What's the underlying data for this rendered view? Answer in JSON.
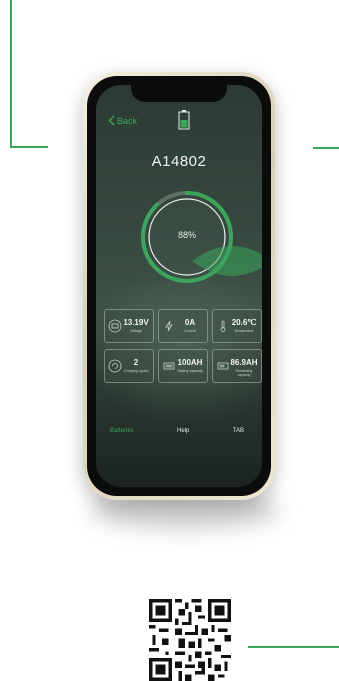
{
  "app": {
    "back_label": "Back",
    "device_name": "A14802",
    "charge_percent": 88,
    "charge_label": "88%"
  },
  "stats": [
    {
      "value": "13.19V",
      "label": "Voltage",
      "icon": "battery-icon"
    },
    {
      "value": "0A",
      "label": "Current",
      "icon": "current-icon"
    },
    {
      "value": "20.6℃",
      "label": "Temperature",
      "icon": "thermometer-icon"
    },
    {
      "value": "2",
      "label": "Charging cycles",
      "icon": "cycle-icon"
    },
    {
      "value": "100AH",
      "label": "Battery capacity",
      "icon": "capacity-icon"
    },
    {
      "value": "86.9AH",
      "label": "Remaining capacity",
      "icon": "remaining-capacity-icon"
    }
  ],
  "tabs": [
    {
      "label": "Batteries",
      "active": true
    },
    {
      "label": "Help",
      "active": false
    },
    {
      "label": "TAB",
      "active": false
    }
  ],
  "colors": {
    "accent": "#3ba55c",
    "screen_bg": "#34463d",
    "phone_frame": "#e9e0cc"
  }
}
